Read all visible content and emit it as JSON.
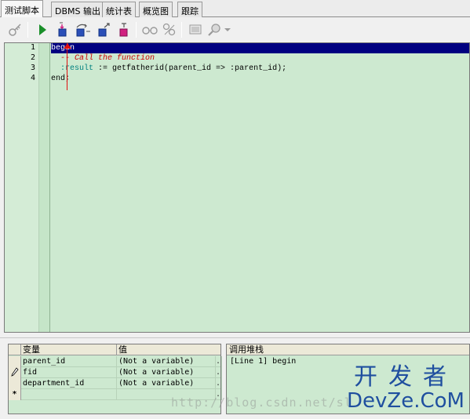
{
  "tabs": [
    {
      "label": "测试脚本",
      "active": true
    },
    {
      "label": "DBMS 输出",
      "active": false
    },
    {
      "label": "统计表",
      "active": false
    },
    {
      "label": "概览图",
      "active": false
    },
    {
      "label": "跟踪",
      "active": false
    }
  ],
  "toolbar": {
    "icons": [
      "debug-settings-icon",
      "execute-icon",
      "step-into-icon",
      "step-over-icon",
      "step-out-icon",
      "run-to-exception-icon",
      "watch-glasses-icon",
      "set-variable-icon",
      "screen-icon",
      "search-icon",
      "dropdown-arrow-icon"
    ],
    "colors": {
      "execute": "#1a8f2a",
      "debug_blue": "#2b4fb8",
      "debug_pink": "#d02080",
      "disabled": "#9a9a9a"
    }
  },
  "editor": {
    "line_numbers": [
      "1",
      "2",
      "3",
      "4"
    ],
    "lines": [
      {
        "text": "begin",
        "highlighted": true
      },
      {
        "indent": "  ",
        "comment": "-- Call the function"
      },
      {
        "indent": "  ",
        "bind": ":result",
        "rest": " := getfatherid(parent_id => :parent_id);"
      },
      {
        "text": "end;"
      }
    ],
    "colors": {
      "background": "#cde9d0",
      "highlight": "#000080",
      "comment": "#cc0000",
      "bind": "#008080"
    }
  },
  "variables": {
    "header_var": "变量",
    "header_val": "值",
    "rows": [
      {
        "indicator": "",
        "name": "parent_id",
        "value": "(Not a variable)",
        "dots": "..."
      },
      {
        "indicator": "",
        "name": "fid",
        "value": "(Not a variable)",
        "dots": "..."
      },
      {
        "indicator": "",
        "name": "department_id",
        "value": "(Not a variable)",
        "dots": "..."
      },
      {
        "indicator": "*",
        "name": "",
        "value": "",
        "dots": "..."
      }
    ]
  },
  "callstack": {
    "header": "调用堆栈",
    "entries": [
      "[Line 1] begin"
    ]
  },
  "watermark": {
    "url": "http://blog.csdn.net/sl",
    "logo_cn": "开发者",
    "logo_en": "DevZe.CoM"
  }
}
